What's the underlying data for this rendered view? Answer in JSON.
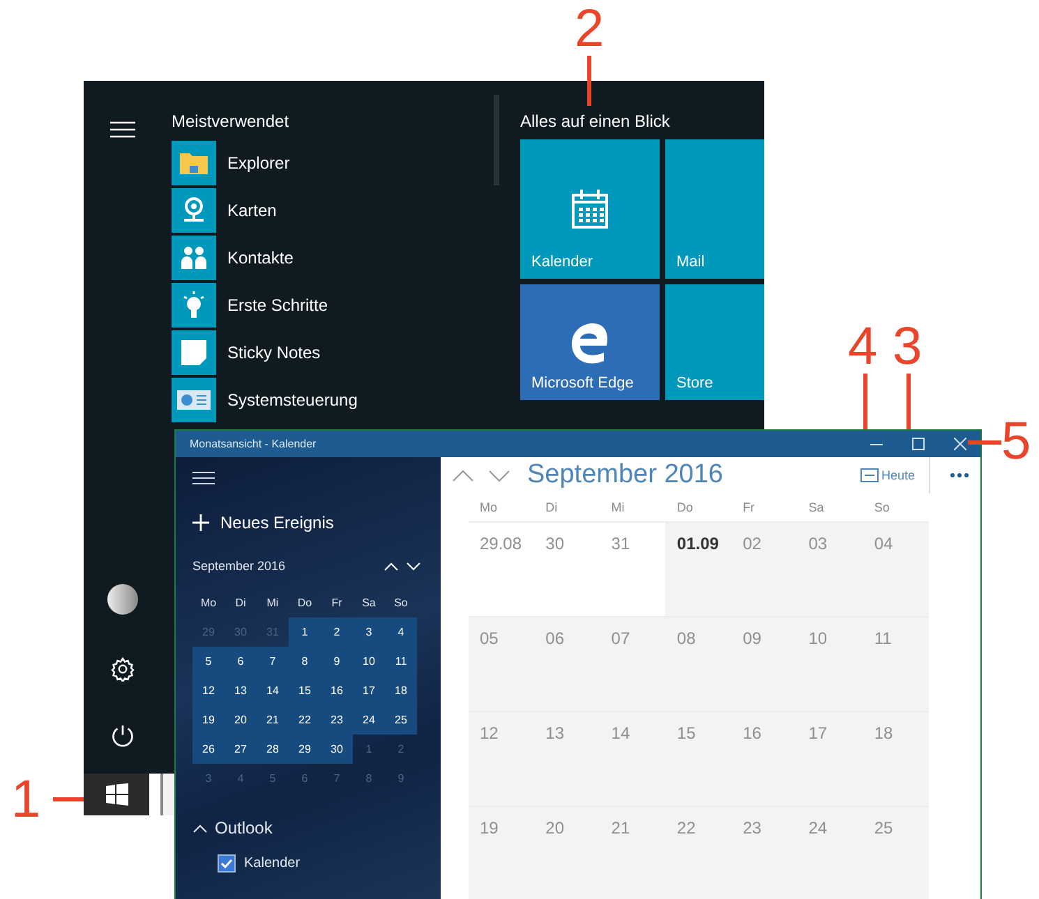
{
  "callouts": [
    {
      "label": "1"
    },
    {
      "label": "2"
    },
    {
      "label": "3"
    },
    {
      "label": "4"
    },
    {
      "label": "5"
    }
  ],
  "start_menu": {
    "section_title": "Meistverwendet",
    "apps": [
      {
        "name": "Explorer",
        "kind": "folder"
      },
      {
        "name": "Karten",
        "kind": "map"
      },
      {
        "name": "Kontakte",
        "kind": "people"
      },
      {
        "name": "Erste Schritte",
        "kind": "bulb"
      },
      {
        "name": "Sticky Notes",
        "kind": "note"
      },
      {
        "name": "Systemsteuerung",
        "kind": "panel"
      }
    ],
    "tiles_title": "Alles auf einen Blick",
    "tiles": [
      {
        "label": "Kalender",
        "kind": "calendar",
        "color": "#0099bc"
      },
      {
        "label": "Mail",
        "kind": "mail",
        "color": "#0099bc"
      },
      {
        "label": "Microsoft Edge",
        "kind": "edge",
        "color": "#2d6db5"
      },
      {
        "label": "Store",
        "kind": "store",
        "color": "#0099bc"
      }
    ]
  },
  "calendar_window": {
    "title": "Monatsansicht - Kalender",
    "new_event": "Neues Ereignis",
    "mini": {
      "month": "September 2016",
      "weekdays": [
        "Mo",
        "Di",
        "Mi",
        "Do",
        "Fr",
        "Sa",
        "So"
      ],
      "days": [
        {
          "label": "29",
          "in_month": false
        },
        {
          "label": "30",
          "in_month": false
        },
        {
          "label": "31",
          "in_month": false
        },
        {
          "label": "1",
          "in_month": true
        },
        {
          "label": "2",
          "in_month": true
        },
        {
          "label": "3",
          "in_month": true
        },
        {
          "label": "4",
          "in_month": true
        },
        {
          "label": "5",
          "in_month": true
        },
        {
          "label": "6",
          "in_month": true
        },
        {
          "label": "7",
          "in_month": true
        },
        {
          "label": "8",
          "in_month": true
        },
        {
          "label": "9",
          "in_month": true
        },
        {
          "label": "10",
          "in_month": true
        },
        {
          "label": "11",
          "in_month": true
        },
        {
          "label": "12",
          "in_month": true
        },
        {
          "label": "13",
          "in_month": true
        },
        {
          "label": "14",
          "in_month": true
        },
        {
          "label": "15",
          "in_month": true
        },
        {
          "label": "16",
          "in_month": true
        },
        {
          "label": "17",
          "in_month": true
        },
        {
          "label": "18",
          "in_month": true
        },
        {
          "label": "19",
          "in_month": true
        },
        {
          "label": "20",
          "in_month": true
        },
        {
          "label": "21",
          "in_month": true
        },
        {
          "label": "22",
          "in_month": true
        },
        {
          "label": "23",
          "in_month": true
        },
        {
          "label": "24",
          "in_month": true
        },
        {
          "label": "25",
          "in_month": true
        },
        {
          "label": "26",
          "in_month": true
        },
        {
          "label": "27",
          "in_month": true
        },
        {
          "label": "28",
          "in_month": true
        },
        {
          "label": "29",
          "in_month": true
        },
        {
          "label": "30",
          "in_month": true
        },
        {
          "label": "1",
          "in_month": false
        },
        {
          "label": "2",
          "in_month": false
        },
        {
          "label": "3",
          "in_month": false
        },
        {
          "label": "4",
          "in_month": false
        },
        {
          "label": "5",
          "in_month": false
        },
        {
          "label": "6",
          "in_month": false
        },
        {
          "label": "7",
          "in_month": false
        },
        {
          "label": "8",
          "in_month": false
        },
        {
          "label": "9",
          "in_month": false
        }
      ]
    },
    "accounts": [
      {
        "name": "Outlook",
        "expanded": true,
        "calendars": [
          {
            "name": "Kalender",
            "checked": true
          }
        ]
      }
    ],
    "month_title": "September 2016",
    "today_button": "Heute",
    "weekdays": [
      "Mo",
      "Di",
      "Mi",
      "Do",
      "Fr",
      "Sa",
      "So"
    ],
    "weeks": [
      {
        "days": [
          {
            "label": "29.08",
            "in_month": false,
            "today": false
          },
          {
            "label": "30",
            "in_month": false,
            "today": false
          },
          {
            "label": "31",
            "in_month": false,
            "today": false
          },
          {
            "label": "01.09",
            "in_month": true,
            "today": true
          },
          {
            "label": "02",
            "in_month": true,
            "today": false
          },
          {
            "label": "03",
            "in_month": true,
            "today": false
          },
          {
            "label": "04",
            "in_month": true,
            "today": false
          }
        ]
      },
      {
        "days": [
          {
            "label": "05",
            "in_month": true,
            "today": false
          },
          {
            "label": "06",
            "in_month": true,
            "today": false
          },
          {
            "label": "07",
            "in_month": true,
            "today": false
          },
          {
            "label": "08",
            "in_month": true,
            "today": false
          },
          {
            "label": "09",
            "in_month": true,
            "today": false
          },
          {
            "label": "10",
            "in_month": true,
            "today": false
          },
          {
            "label": "11",
            "in_month": true,
            "today": false
          }
        ]
      },
      {
        "days": [
          {
            "label": "12",
            "in_month": true,
            "today": false
          },
          {
            "label": "13",
            "in_month": true,
            "today": false
          },
          {
            "label": "14",
            "in_month": true,
            "today": false
          },
          {
            "label": "15",
            "in_month": true,
            "today": false
          },
          {
            "label": "16",
            "in_month": true,
            "today": false
          },
          {
            "label": "17",
            "in_month": true,
            "today": false
          },
          {
            "label": "18",
            "in_month": true,
            "today": false
          }
        ]
      },
      {
        "days": [
          {
            "label": "19",
            "in_month": true,
            "today": false
          },
          {
            "label": "20",
            "in_month": true,
            "today": false
          },
          {
            "label": "21",
            "in_month": true,
            "today": false
          },
          {
            "label": "22",
            "in_month": true,
            "today": false
          },
          {
            "label": "23",
            "in_month": true,
            "today": false
          },
          {
            "label": "24",
            "in_month": true,
            "today": false
          },
          {
            "label": "25",
            "in_month": true,
            "today": false
          }
        ]
      }
    ]
  }
}
